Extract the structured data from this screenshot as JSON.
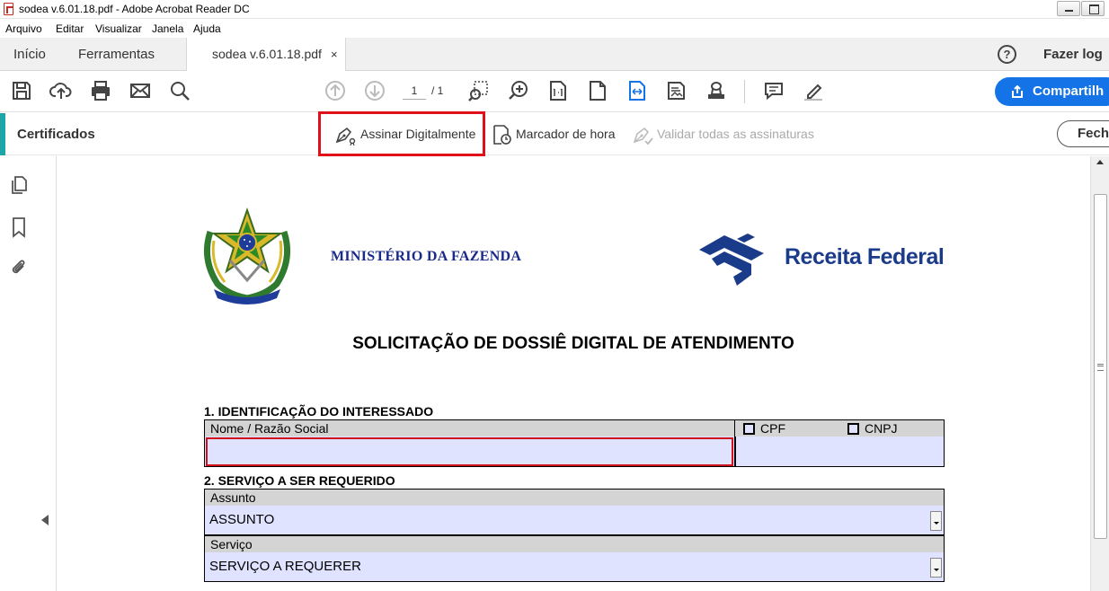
{
  "window": {
    "title": "sodea v.6.01.18.pdf - Adobe Acrobat Reader DC"
  },
  "menu": [
    "Arquivo",
    "Editar",
    "Visualizar",
    "Janela",
    "Ajuda"
  ],
  "tabs": {
    "home": "Início",
    "tools": "Ferramentas",
    "document": "sodea v.6.01.18.pdf",
    "close_glyph": "×"
  },
  "header_right": {
    "help_glyph": "?",
    "login": "Fazer log"
  },
  "toolbar": {
    "page_current": "1",
    "page_total": "/ 1",
    "share_label": "Compartilh"
  },
  "cert_toolbar": {
    "title": "Certificados",
    "sign": "Assinar Digitalmente",
    "timestamp": "Marcador de hora",
    "validate": "Validar todas as assinaturas",
    "close": "Fecha"
  },
  "document": {
    "ministry": "MINISTÉRIO DA FAZENDA",
    "agency": "Receita Federal",
    "form_title": "SOLICITAÇÃO DE DOSSIÊ DIGITAL DE ATENDIMENTO",
    "section1": {
      "title": "1. IDENTIFICAÇÃO DO INTERESSADO",
      "name_label": "Nome / Razão Social",
      "name_value": "",
      "cpf_label": "CPF",
      "cnpj_label": "CNPJ"
    },
    "section2": {
      "title": "2. SERVIÇO A SER REQUERIDO",
      "subject_label": "Assunto",
      "subject_value": "ASSUNTO",
      "service_label": "Serviço",
      "service_value": "SERVIÇO A REQUERER"
    }
  },
  "colors": {
    "accent": "#1473e6",
    "highlight": "#e0101a",
    "field_fill": "#dfe3ff",
    "cert_accent": "#1ea6a6"
  }
}
